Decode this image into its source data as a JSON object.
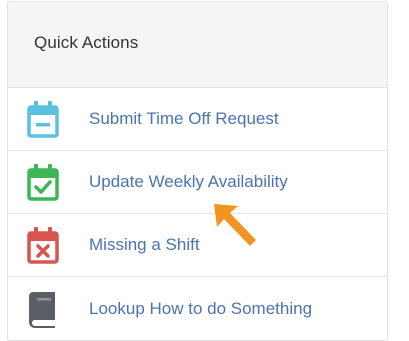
{
  "panel": {
    "title": "Quick Actions"
  },
  "actions": [
    {
      "label": "Submit Time Off Request",
      "icon": "calendar-minus-icon",
      "color": "#5bc0de"
    },
    {
      "label": "Update Weekly Availability",
      "icon": "calendar-check-icon",
      "color": "#3cb554"
    },
    {
      "label": "Missing a Shift",
      "icon": "calendar-x-icon",
      "color": "#d9534f"
    },
    {
      "label": "Lookup How to do Something",
      "icon": "book-icon",
      "color": "#5a5f66"
    }
  ],
  "annotation": {
    "icon": "arrow-pointer-icon",
    "color": "#f39422"
  }
}
